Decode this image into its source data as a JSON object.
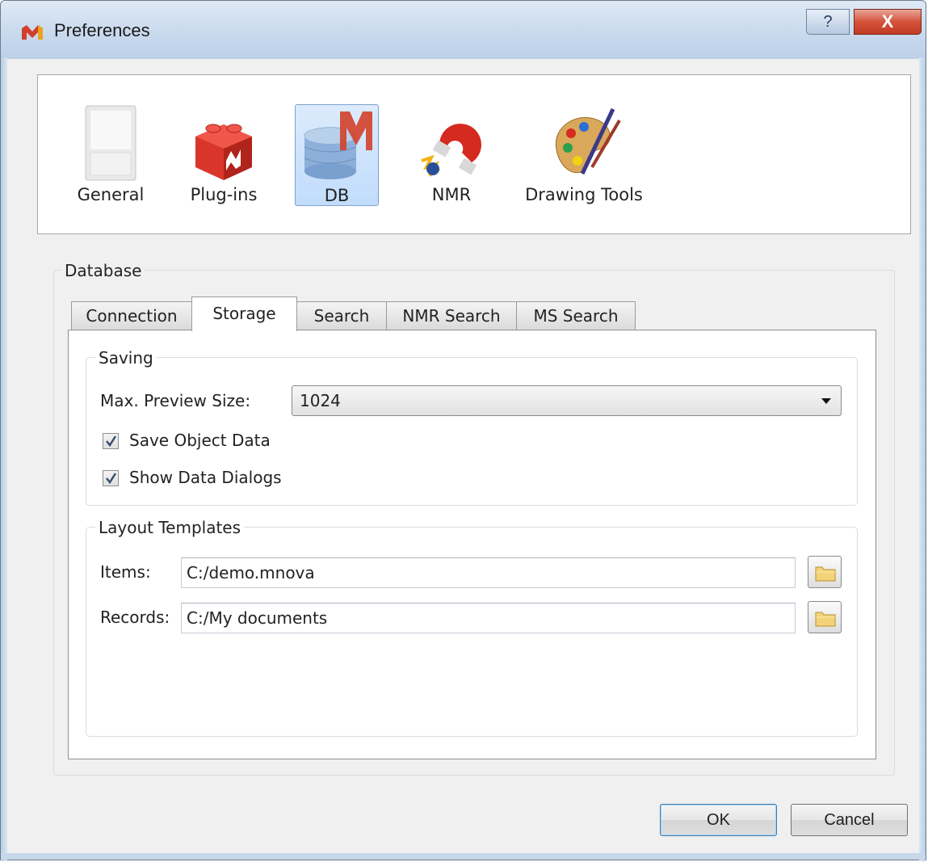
{
  "window": {
    "title": "Preferences",
    "help_glyph": "?",
    "close_glyph": "X"
  },
  "categories": [
    {
      "label": "General",
      "icon": "general-icon",
      "selected": false
    },
    {
      "label": "Plug-ins",
      "icon": "plugins-icon",
      "selected": false
    },
    {
      "label": "DB",
      "icon": "db-icon",
      "selected": true
    },
    {
      "label": "NMR",
      "icon": "nmr-icon",
      "selected": false
    },
    {
      "label": "Drawing Tools",
      "icon": "drawing-tools-icon",
      "selected": false
    }
  ],
  "database": {
    "group_title": "Database",
    "tabs": [
      {
        "label": "Connection",
        "active": false
      },
      {
        "label": "Storage",
        "active": true
      },
      {
        "label": "Search",
        "active": false
      },
      {
        "label": "NMR Search",
        "active": false
      },
      {
        "label": "MS Search",
        "active": false
      }
    ]
  },
  "saving": {
    "group_title": "Saving",
    "max_preview_label": "Max. Preview Size:",
    "max_preview_value": "1024",
    "save_object_data": {
      "label": "Save Object Data",
      "checked": true
    },
    "show_data_dialogs": {
      "label": "Show Data Dialogs",
      "checked": true
    }
  },
  "layout_templates": {
    "group_title": "Layout Templates",
    "items_label": "Items:",
    "items_value": "C:/demo.mnova",
    "records_label": "Records:",
    "records_value": "C:/My documents"
  },
  "buttons": {
    "ok": "OK",
    "cancel": "Cancel"
  },
  "colors": {
    "accent_selection": "#c1dcfc",
    "close_button": "#d4533b",
    "titlebar": "#c9daee"
  }
}
